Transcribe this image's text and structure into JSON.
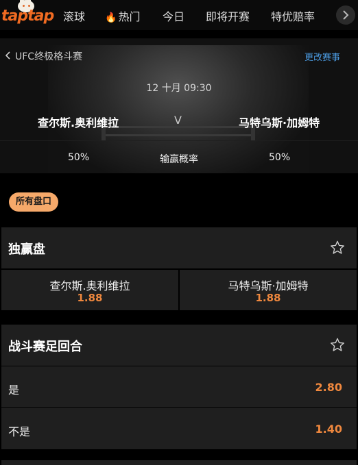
{
  "nav": {
    "logo_text": "taptap",
    "items": [
      "滚球",
      "热门",
      "今日",
      "即将开赛",
      "特优赔率"
    ]
  },
  "event": {
    "back_label": "UFC终极格斗赛",
    "change_label": "更改赛事",
    "datetime": "12 十月 09:30",
    "team_a": "查尔斯.奥利维拉",
    "vs": "V",
    "team_b": "马特乌斯·加姆特",
    "prob_a": "50%",
    "prob_label": "输赢概率",
    "prob_b": "50%"
  },
  "filter": {
    "all_label": "所有盘口"
  },
  "markets": {
    "moneyline": {
      "title": "独赢盘",
      "options": [
        {
          "name": "查尔斯.奥利维拉",
          "odds": "1.88"
        },
        {
          "name": "马特乌斯·加姆特",
          "odds": "1.88"
        }
      ]
    },
    "distance": {
      "title": "战斗赛足回合",
      "rows": [
        {
          "label": "是",
          "odds": "2.80"
        },
        {
          "label": "不是",
          "odds": "1.40"
        }
      ]
    }
  },
  "icons": {
    "back": "chevron-left-icon",
    "next": "chevron-right-icon",
    "fire": "fire-icon",
    "favorite": "star-outline-icon"
  },
  "colors": {
    "accent_odds": "#f0883e",
    "link": "#4b9ae0",
    "pill_bg": "#f6a96a",
    "logo": "#f06b22"
  }
}
